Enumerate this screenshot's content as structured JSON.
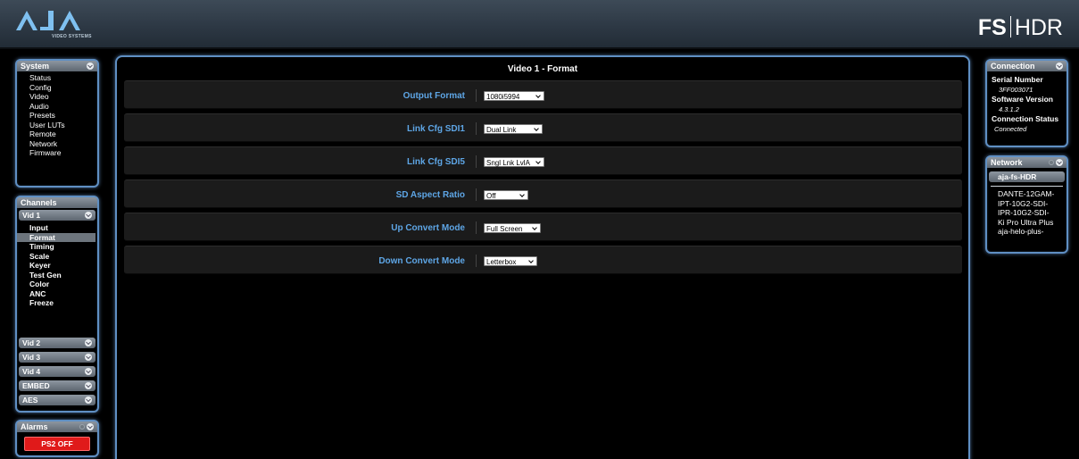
{
  "header": {
    "logo_text": "AJA",
    "logo_subtext": "VIDEO SYSTEMS",
    "product_bold": "FS",
    "product_light": "HDR"
  },
  "system_panel": {
    "title": "System",
    "items": [
      "Status",
      "Config",
      "Video",
      "Audio",
      "Presets",
      "User LUTs",
      "Remote",
      "Network",
      "Firmware"
    ]
  },
  "channels_panel": {
    "title": "Channels",
    "vid1": {
      "title": "Vid 1",
      "items": [
        "Input",
        "Format",
        "Timing",
        "Scale",
        "Keyer",
        "Test Gen",
        "Color",
        "ANC",
        "Freeze"
      ],
      "selected": "Format"
    },
    "groups": [
      "Vid 2",
      "Vid 3",
      "Vid 4",
      "EMBED",
      "AES"
    ]
  },
  "alarms_panel": {
    "title": "Alarms",
    "button_label": "PS2 OFF"
  },
  "main": {
    "title": "Video 1 - Format",
    "rows": [
      {
        "label": "Output Format",
        "value": "1080i5994"
      },
      {
        "label": "Link Cfg SDI1",
        "value": "Dual Link"
      },
      {
        "label": "Link Cfg SDI5",
        "value": "Sngl Lnk LvlA"
      },
      {
        "label": "SD Aspect Ratio",
        "value": "Off"
      },
      {
        "label": "Up Convert Mode",
        "value": "Full Screen"
      },
      {
        "label": "Down Convert Mode",
        "value": "Letterbox"
      }
    ]
  },
  "connection_panel": {
    "title": "Connection",
    "serial_label": "Serial Number",
    "serial_value": "3FF003071",
    "software_label": "Software Version",
    "software_value": "4.3.1.2",
    "status_label": "Connection Status",
    "status_value": "Connected"
  },
  "network_panel": {
    "title": "Network",
    "current": "aja-fs-HDR",
    "devices": [
      "DANTE-12GAM-",
      "IPT-10G2-SDI-",
      "IPR-10G2-SDI-",
      "Ki Pro Ultra Plus",
      "aja-helo-plus-"
    ]
  },
  "colors": {
    "accent_label": "#5ea6e6",
    "panel_border": "#5f8fc3",
    "alarm_red": "#e01a1a"
  }
}
